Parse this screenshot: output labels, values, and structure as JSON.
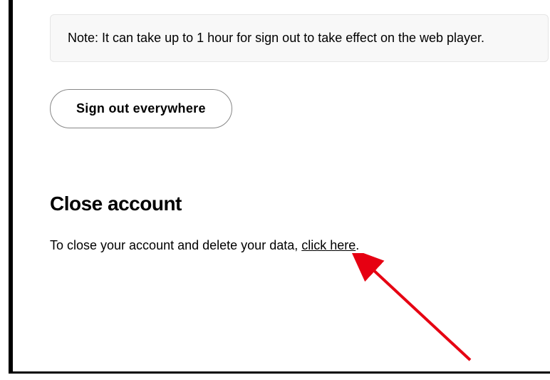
{
  "note": {
    "label": "Note:",
    "text": " It can take up to 1 hour for sign out to take effect on the web player."
  },
  "signout": {
    "button_label": "Sign out everywhere"
  },
  "close_account": {
    "heading": "Close account",
    "text_before": "To close your account and delete your data, ",
    "link_text": "click here",
    "text_after": "."
  },
  "annotation": {
    "color": "#e60012"
  }
}
